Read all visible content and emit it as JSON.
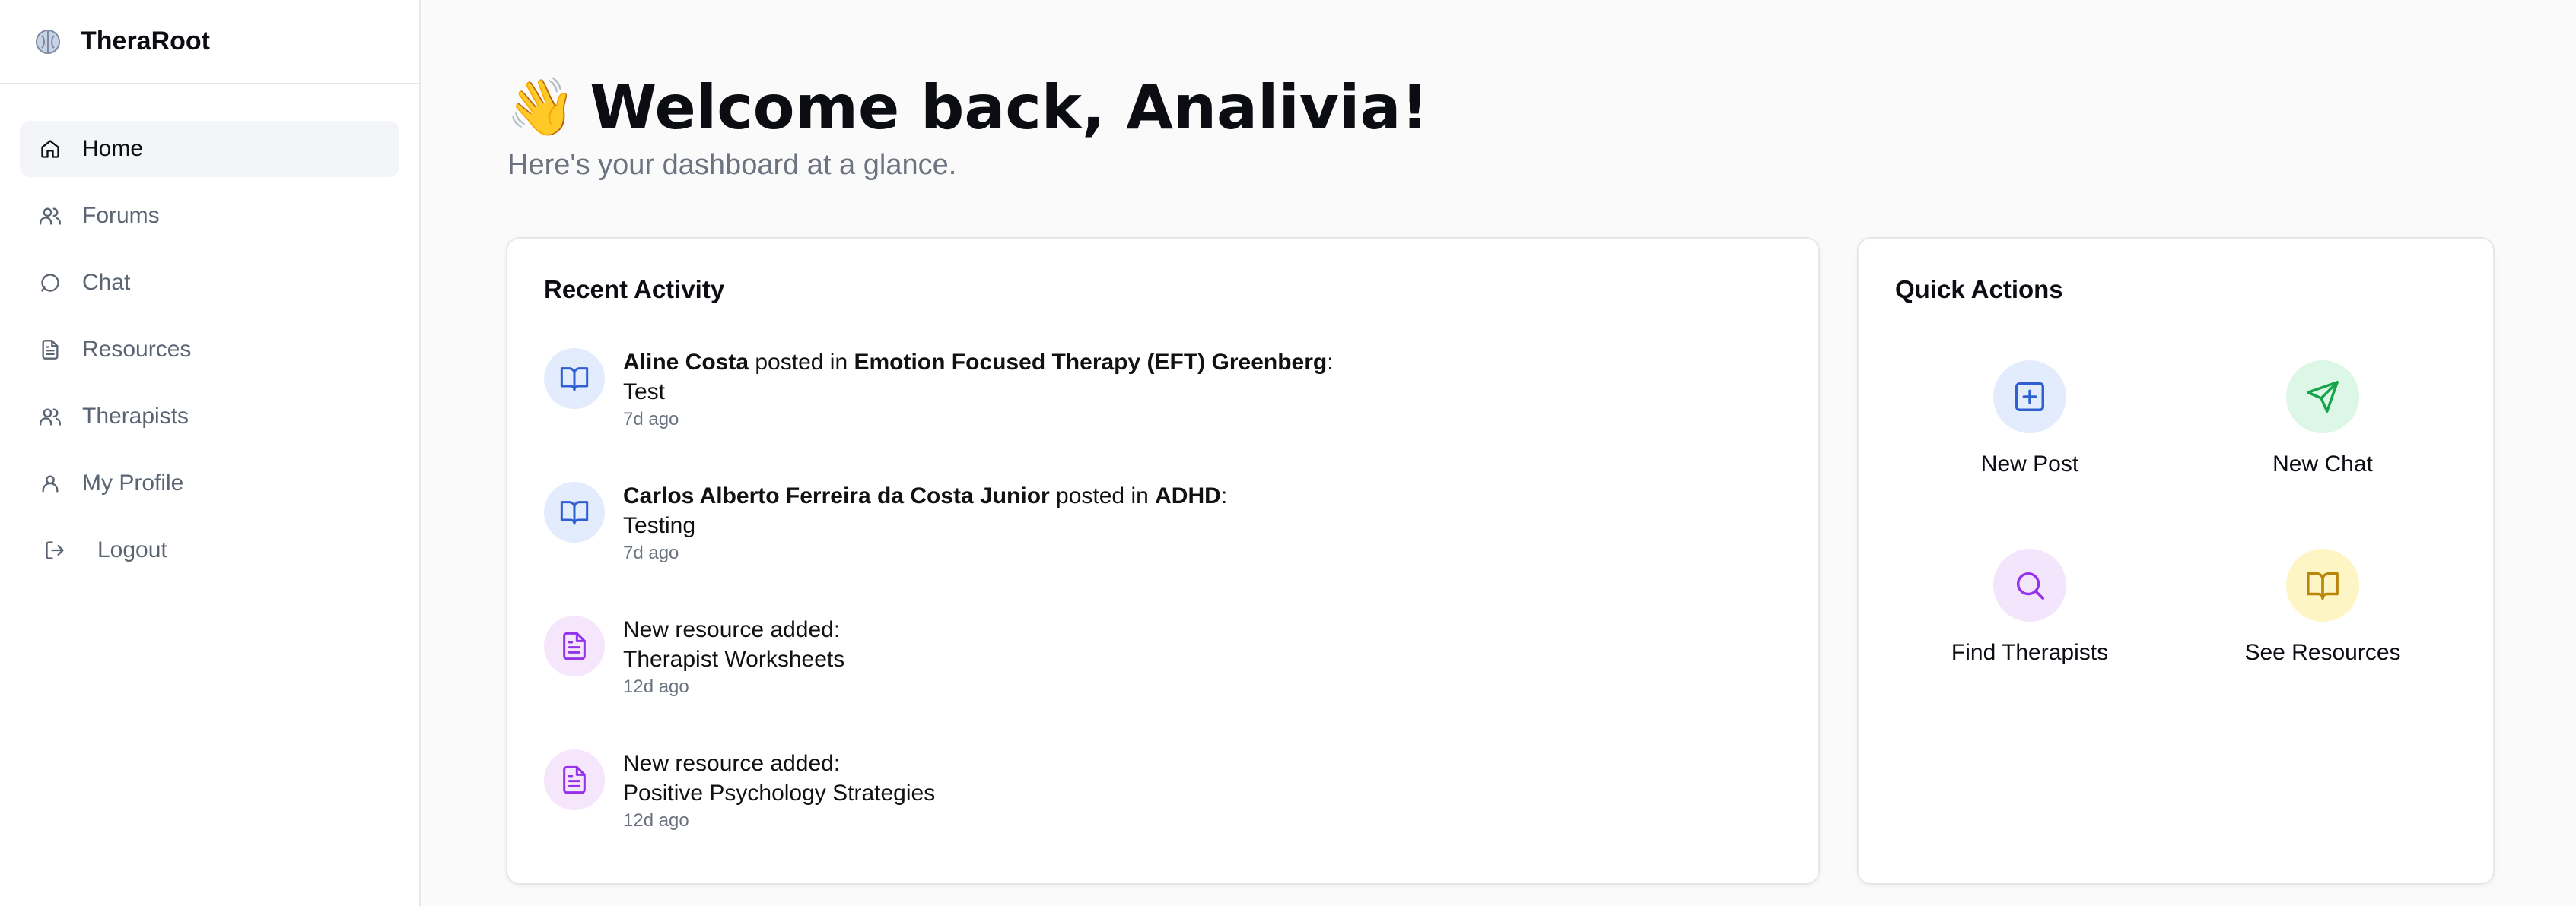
{
  "brand": {
    "name": "TheraRoot",
    "icon": "brain-icon"
  },
  "nav": {
    "items": [
      {
        "label": "Home",
        "icon": "home-icon",
        "active": true
      },
      {
        "label": "Forums",
        "icon": "users-icon"
      },
      {
        "label": "Chat",
        "icon": "chat-bubble-icon"
      },
      {
        "label": "Resources",
        "icon": "document-icon"
      },
      {
        "label": "Therapists",
        "icon": "users-icon"
      },
      {
        "label": "My Profile",
        "icon": "user-icon"
      },
      {
        "label": "Logout",
        "icon": "logout-icon"
      }
    ]
  },
  "header": {
    "wave": "👋",
    "title": "Welcome back, Analivia!",
    "subtitle": "Here's your dashboard at a glance."
  },
  "recent": {
    "title": "Recent Activity",
    "items": [
      {
        "author": "Aline Costa",
        "mid": " posted in ",
        "target": "Emotion Focused Therapy (EFT) Greenberg",
        "end": ":",
        "text": "Test",
        "time": "7d ago",
        "icon": "book-open-icon"
      },
      {
        "author": "Carlos Alberto Ferreira da Costa Junior",
        "mid": " posted in ",
        "target": "ADHD",
        "end": ":",
        "text": "Testing",
        "time": "7d ago",
        "icon": "book-open-icon"
      },
      {
        "prefix": "New resource added:",
        "text": "Therapist Worksheets",
        "time": "12d ago",
        "icon": "document-icon"
      },
      {
        "prefix": "New resource added:",
        "text": "Positive Psychology Strategies",
        "time": "12d ago",
        "icon": "document-icon"
      }
    ]
  },
  "quick": {
    "title": "Quick Actions",
    "actions": [
      {
        "label": "New Post",
        "icon": "plus-square-icon",
        "color": "#2f5fd0",
        "bg": "#e3ecfd"
      },
      {
        "label": "New Chat",
        "icon": "send-icon",
        "color": "#16a34a",
        "bg": "#dcf7e6"
      },
      {
        "label": "Find Therapists",
        "icon": "search-icon",
        "color": "#9333ea",
        "bg": "#f3e5fb"
      },
      {
        "label": "See Resources",
        "icon": "book-open-icon",
        "color": "#b8860b",
        "bg": "#fdf6c4"
      }
    ]
  },
  "colors": {
    "activity_blue": "#2f5fd0",
    "activity_purple": "#9333ea",
    "muted": "#6b7280"
  }
}
